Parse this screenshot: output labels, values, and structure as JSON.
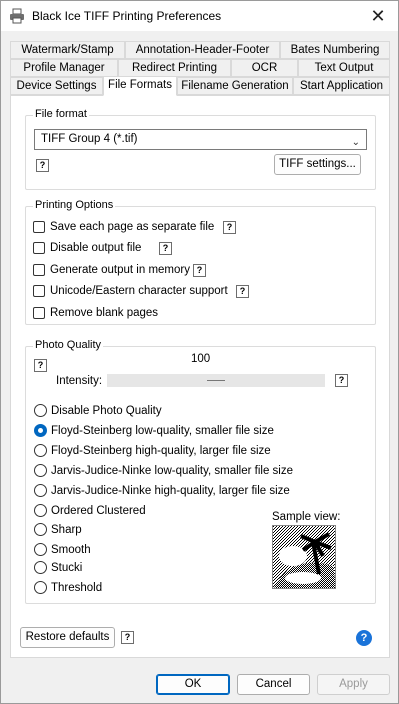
{
  "window": {
    "title": "Black Ice TIFF Printing Preferences",
    "close_glyph": "✕"
  },
  "tabs": {
    "row1": [
      "Watermark/Stamp",
      "Annotation-Header-Footer",
      "Bates Numbering"
    ],
    "row2": [
      "Profile Manager",
      "Redirect Printing",
      "OCR",
      "Text Output"
    ],
    "row3": [
      "Device Settings",
      "File Formats",
      "Filename Generation",
      "Start Application"
    ],
    "active": "File Formats"
  },
  "file_format": {
    "group_label": "File format",
    "selected": "TIFF Group 4 (*.tif)",
    "settings_button": "TIFF settings..."
  },
  "printing_options": {
    "group_label": "Printing Options",
    "items": [
      {
        "label": "Save each page as separate file",
        "checked": false,
        "help": true
      },
      {
        "label": "Disable output file",
        "checked": false,
        "help": true
      },
      {
        "label": "Generate output in memory",
        "checked": false,
        "help": true
      },
      {
        "label": "Unicode/Eastern character support",
        "checked": false,
        "help": true
      },
      {
        "label": "Remove blank pages",
        "checked": false,
        "help": false
      }
    ]
  },
  "photo_quality": {
    "group_label": "Photo Quality",
    "intensity_value": "100",
    "intensity_label": "Intensity:",
    "intensity_level": 100,
    "options": [
      "Disable Photo Quality",
      "Floyd-Steinberg low-quality, smaller file size",
      "Floyd-Steinberg high-quality, larger file size",
      "Jarvis-Judice-Ninke low-quality, smaller file size",
      "Jarvis-Judice-Ninke high-quality, larger file size",
      "Ordered Clustered",
      "Sharp",
      "Smooth",
      "Stucki",
      "Threshold"
    ],
    "selected_index": 1,
    "sample_label": "Sample view:"
  },
  "footer": {
    "restore_defaults": "Restore defaults",
    "ok": "OK",
    "cancel": "Cancel",
    "apply": "Apply",
    "help_glyph": "?"
  },
  "colors": {
    "accent": "#0067c0",
    "help": "#1a73d9"
  }
}
